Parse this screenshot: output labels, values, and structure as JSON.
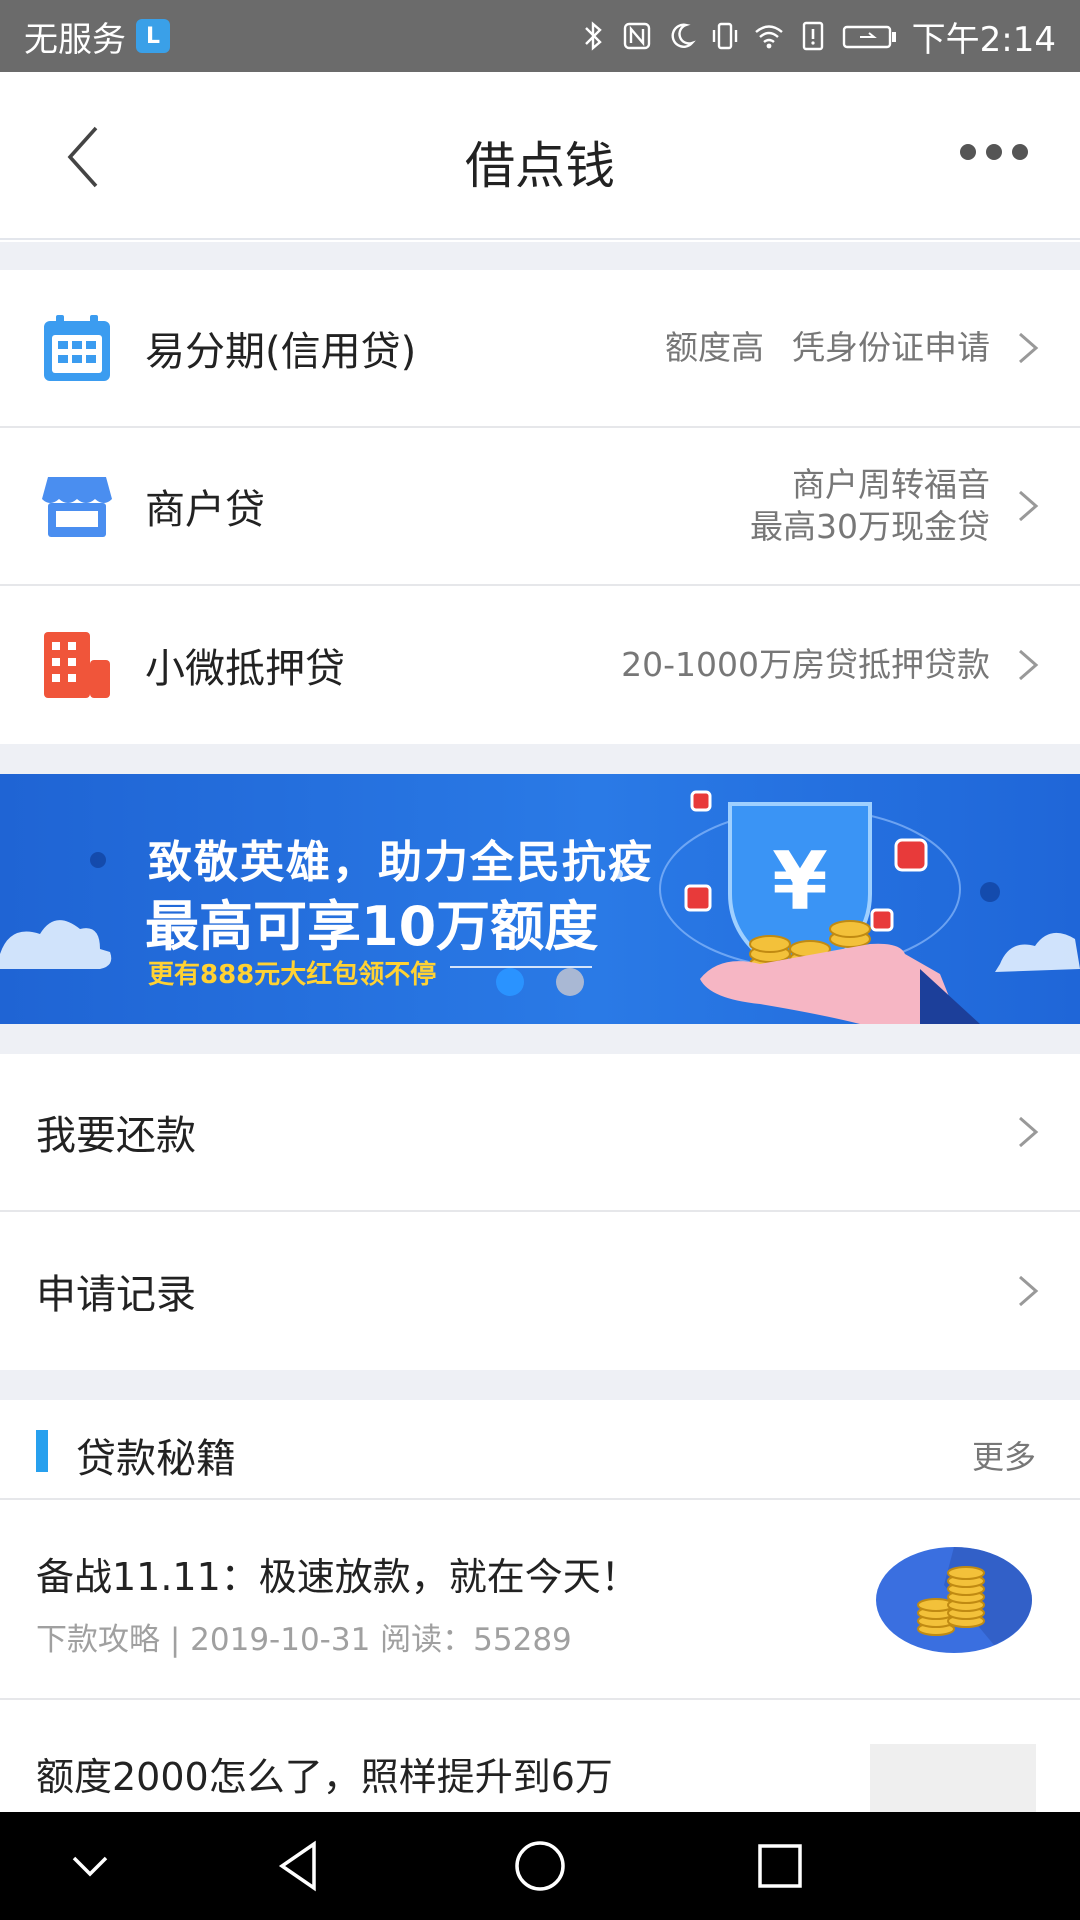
{
  "status_bar": {
    "carrier": "无服务",
    "app_badge": "L",
    "time": "下午2:14",
    "icons": [
      "bluetooth-icon",
      "nfc-icon",
      "moon-icon",
      "vibrate-icon",
      "wifi-icon",
      "alert-icon",
      "battery-icon"
    ]
  },
  "header": {
    "title": "借点钱"
  },
  "loans": [
    {
      "title": "易分期(信用贷)",
      "desc_a": "额度高",
      "desc_b": "凭身份证申请",
      "icon": "calendar-icon",
      "color": "#3b9cf0"
    },
    {
      "title": "商户贷",
      "desc_a": "商户周转福音",
      "desc_b": "最高30万现金贷",
      "icon": "store-icon",
      "color": "#4a8ef0"
    },
    {
      "title": "小微抵押贷",
      "desc_a": "20-1000万房贷抵押贷款",
      "icon": "building-icon",
      "color": "#f0553a"
    }
  ],
  "banner": {
    "line1": "致敬英雄，助力全民抗疫",
    "line2": "最高可享10万额度",
    "line3": "更有888元大红包领不停"
  },
  "menu": [
    {
      "label": "我要还款"
    },
    {
      "label": "申请记录"
    }
  ],
  "tips": {
    "title": "贷款秘籍",
    "more": "更多",
    "articles": [
      {
        "title": "备战11.11：极速放款，就在今天！",
        "meta": "下款攻略 | 2019-10-31 阅读：55289"
      },
      {
        "title": "额度2000怎么了，照样提升到6万"
      }
    ]
  },
  "colors": {
    "accent": "#27a0ee",
    "banner": "#2a7ae6",
    "banner_highlight": "#ffd233"
  }
}
